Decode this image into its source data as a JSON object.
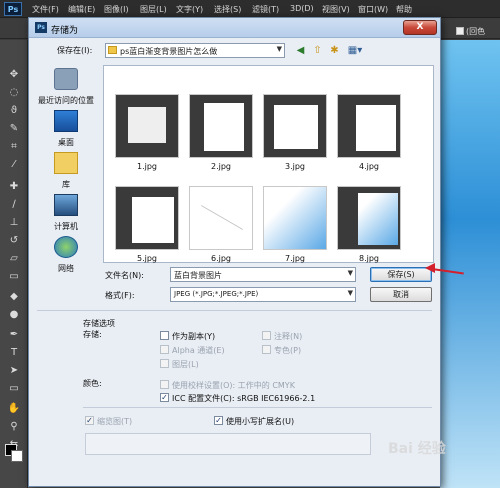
{
  "ps": {
    "logo": "Ps",
    "menus": [
      "文件(F)",
      "编辑(E)",
      "图像(I)",
      "图层(L)",
      "文字(Y)",
      "选择(S)",
      "滤镜(T)",
      "3D(D)",
      "视图(V)",
      "窗口(W)",
      "帮助"
    ],
    "right_option": "(回色"
  },
  "dialog": {
    "title": "存储为",
    "close_label": "X",
    "save_in_label": "保存在(I):",
    "save_in_value": "ps蓝白渐变背景图片怎么做",
    "places": [
      {
        "label": "最近访问的位置",
        "icon": "recent-places-icon"
      },
      {
        "label": "桌面",
        "icon": "desktop-icon"
      },
      {
        "label": "库",
        "icon": "library-icon"
      },
      {
        "label": "计算机",
        "icon": "computer-icon"
      },
      {
        "label": "网络",
        "icon": "network-icon"
      }
    ],
    "files": [
      "1.jpg",
      "2.jpg",
      "3.jpg",
      "4.jpg",
      "5.jpg",
      "6.jpg",
      "7.jpg",
      "8.jpg"
    ],
    "filename_label": "文件名(N):",
    "filename_value": "蓝白背景图片",
    "format_label": "格式(F):",
    "format_value": "JPEG (*.JPG;*.JPEG;*.JPE)",
    "save_button": "保存(S)",
    "cancel_button": "取消",
    "options": {
      "section_title": "存储选项",
      "store_label": "存储:",
      "as_copy": "作为副本(Y)",
      "alpha": "Alpha 通道(E)",
      "layers": "图层(L)",
      "notes": "注释(N)",
      "spot": "专色(P)",
      "color_label": "颜色:",
      "proof": "使用校样设置(O): 工作中的 CMYK",
      "icc": "ICC 配置文件(C): sRGB IEC61966-2.1",
      "thumbnail": "缩览图(T)",
      "lowercase_ext": "使用小写扩展名(U)"
    }
  },
  "watermark": "Bai 经验"
}
